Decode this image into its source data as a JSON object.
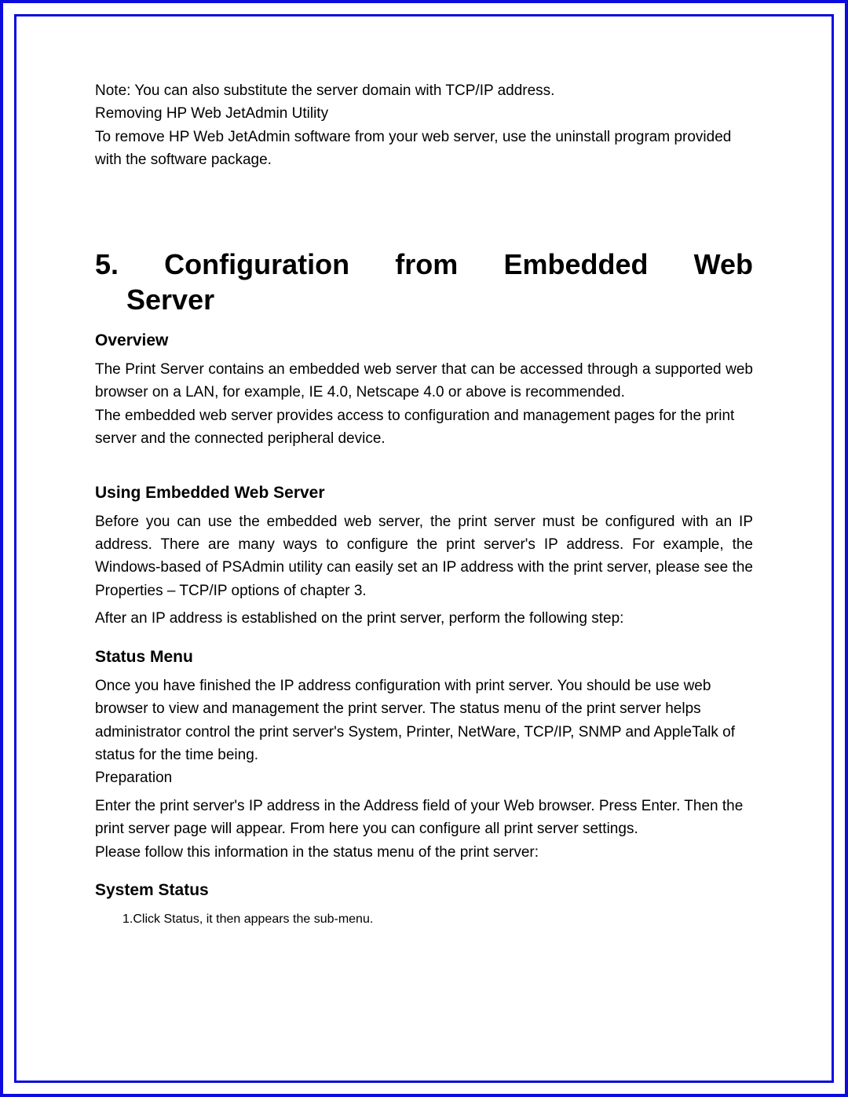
{
  "intro": {
    "note": "Note: You can also substitute the server domain with TCP/IP address.",
    "removing_title": "Removing HP Web JetAdmin Utility",
    "removing_body": "To remove HP Web JetAdmin software from your web server, use the uninstall program provided with the software package."
  },
  "chapter": {
    "line1": "5.  Configuration  from  Embedded  Web",
    "line2": "Server"
  },
  "overview": {
    "heading": "Overview",
    "p1": "The Print Server contains an embedded web server that can be accessed through a supported web browser on a LAN, for example, IE 4.0, Netscape 4.0 or above is recommended.",
    "p2": "The embedded web server provides access to configuration and management pages for the print server and the connected peripheral device."
  },
  "using": {
    "heading": "Using Embedded Web Server",
    "p1": "Before you can use the embedded web server, the print server must be configured with an IP address. There are many ways to configure the print server's IP address. For example, the Windows-based of PSAdmin utility can easily set an IP address with the print server, please see the Properties – TCP/IP options of chapter 3.",
    "p2": "After an IP address is established on the print server, perform the following step:"
  },
  "status_menu": {
    "heading": "Status Menu",
    "p1": "Once you have finished the IP address configuration with print server. You should be use web browser to view and management the print server. The status menu of the print server helps administrator control the print server's System, Printer, NetWare, TCP/IP, SNMP and AppleTalk of status for the time being.",
    "preparation": "Preparation",
    "p2": "Enter the print server's IP address in the Address field of your Web browser. Press Enter. Then the print server page will appear. From here you can configure all print server settings.",
    "p3": "Please follow this information in the status menu of the print server:"
  },
  "system_status": {
    "heading": "System Status",
    "item1": "Click Status, it then appears the sub-menu."
  }
}
